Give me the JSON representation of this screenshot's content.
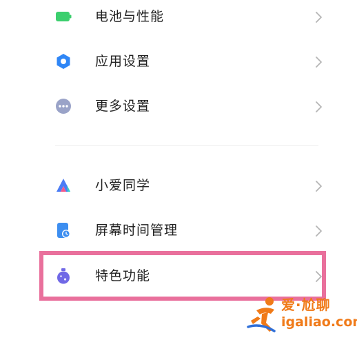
{
  "settings_list": {
    "items": [
      {
        "label": "电池与性能",
        "icon": "battery-icon",
        "icon_color": "#3ccf6e"
      },
      {
        "label": "应用设置",
        "icon": "gear-icon",
        "icon_color": "#2f86f6"
      },
      {
        "label": "更多设置",
        "icon": "more-dots-icon",
        "icon_color": "#9aa3c8"
      },
      {
        "label": "小爱同学",
        "icon": "xiaoai-icon",
        "icon_color": "#4b7cf5"
      },
      {
        "label": "屏幕时间管理",
        "icon": "screen-time-icon",
        "icon_color": "#3d8ef0"
      },
      {
        "label": "特色功能",
        "icon": "flask-icon",
        "icon_color": "#7068e6"
      }
    ],
    "chevron": "chevron-right-icon"
  },
  "highlight": {
    "color": "#e9709c",
    "target": "特色功能"
  },
  "watermark": {
    "title": "爱·尬聊",
    "domain": "igaliao.com",
    "color": "#f07a18"
  }
}
